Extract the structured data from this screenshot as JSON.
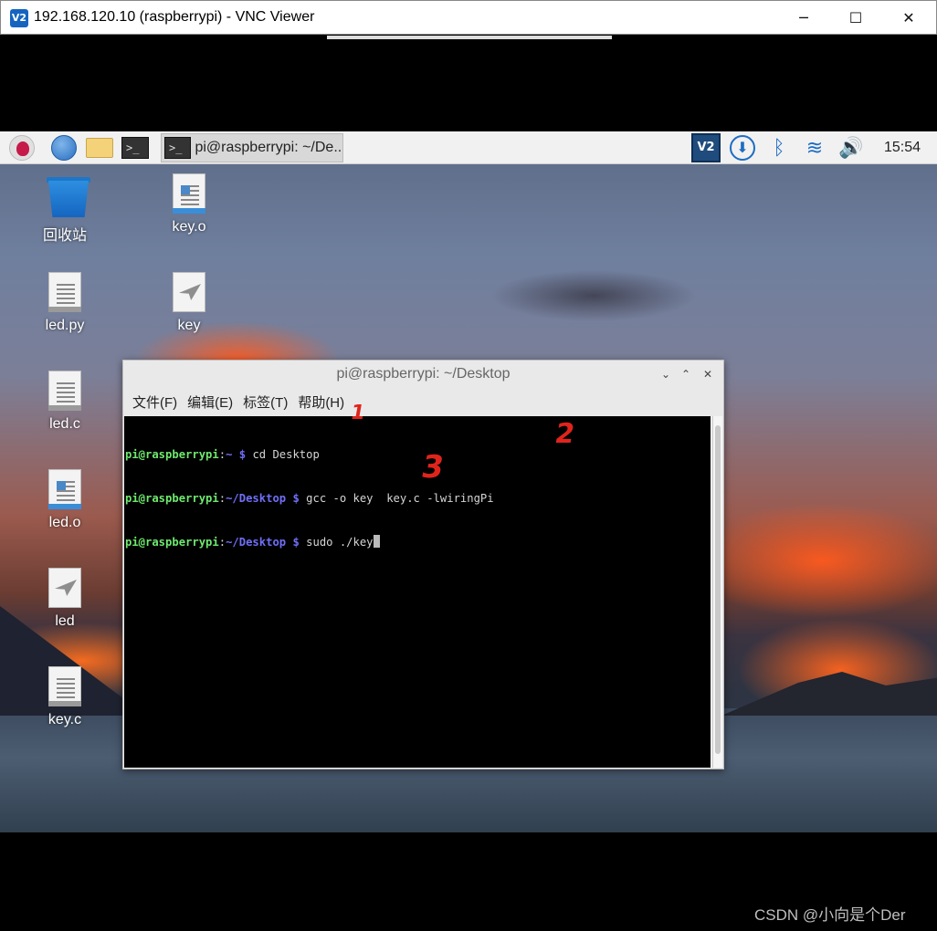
{
  "window": {
    "title": "192.168.120.10 (raspberrypi) - VNC Viewer",
    "logo": "V2",
    "controls": {
      "minimize": "─",
      "maximize": "☐",
      "close": "✕"
    }
  },
  "panel": {
    "task_label": "pi@raspberrypi: ~/De...",
    "term_glyph": ">_",
    "vnc_logo": "V2",
    "download_glyph": "⬇",
    "bluetooth_glyph": "ᛒ",
    "wifi_glyph": "≋",
    "volume_glyph": "🔊",
    "clock": "15:54"
  },
  "desktop": {
    "icons": [
      {
        "label": "回收站",
        "type": "trash-icon"
      },
      {
        "label": "key.o",
        "type": "object-file-icon"
      },
      {
        "label": "led.py",
        "type": "text-file-icon"
      },
      {
        "label": "key",
        "type": "executable-icon"
      },
      {
        "label": "led.c",
        "type": "text-file-icon"
      },
      {
        "label": "led.o",
        "type": "object-file-icon"
      },
      {
        "label": "led",
        "type": "executable-icon"
      },
      {
        "label": "key.c",
        "type": "text-file-icon"
      }
    ]
  },
  "terminal": {
    "title": "pi@raspberrypi: ~/Desktop",
    "controls": {
      "minimize": "⌄",
      "maximize": "⌃",
      "close": "✕"
    },
    "menu": [
      "文件(F)",
      "编辑(E)",
      "标签(T)",
      "帮助(H)"
    ],
    "lines": [
      {
        "user": "pi@raspberrypi",
        "path": "~",
        "prompt": " $ ",
        "cmd": "cd Desktop"
      },
      {
        "user": "pi@raspberrypi",
        "path": "~/Desktop",
        "prompt": " $ ",
        "cmd": "gcc -o key  key.c -lwiringPi"
      },
      {
        "user": "pi@raspberrypi",
        "path": "~/Desktop",
        "prompt": " $ ",
        "cmd": "sudo ./key"
      }
    ]
  },
  "annotations": [
    "1",
    "2",
    "3"
  ],
  "watermark": "CSDN @小向是个Der",
  "colors": {
    "prompt_user": "#6ee86e",
    "prompt_path": "#6f6ff8",
    "annotation": "#e0241c",
    "taskbar": "#f1f1f1"
  }
}
